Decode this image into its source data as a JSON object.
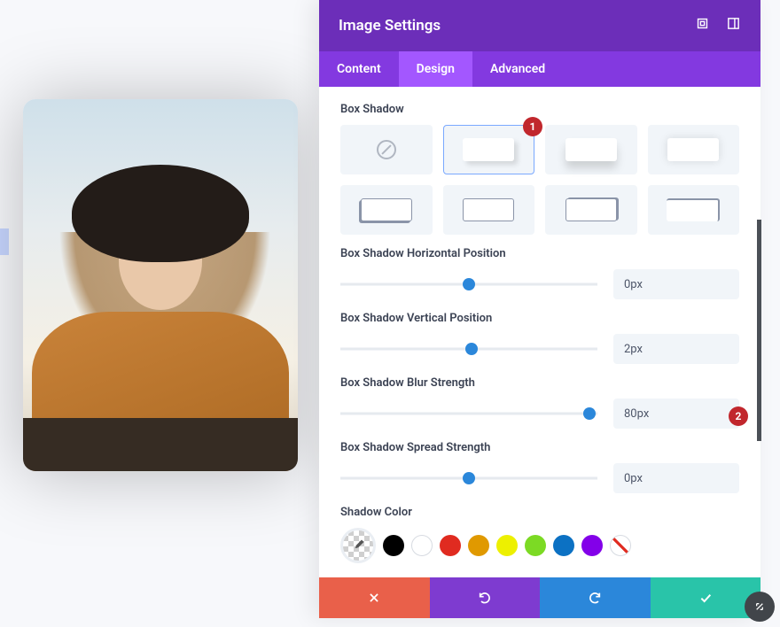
{
  "header": {
    "title": "Image Settings"
  },
  "tabs": {
    "content": "Content",
    "design": "Design",
    "advanced": "Advanced",
    "active": "design"
  },
  "section": {
    "box_shadow_label": "Box Shadow",
    "presets": {
      "selected_index": 1
    }
  },
  "sliders": {
    "horizontal": {
      "label": "Box Shadow Horizontal Position",
      "value": "0px",
      "pos": 50
    },
    "vertical": {
      "label": "Box Shadow Vertical Position",
      "value": "2px",
      "pos": 51
    },
    "blur": {
      "label": "Box Shadow Blur Strength",
      "value": "80px",
      "pos": 97
    },
    "spread": {
      "label": "Box Shadow Spread Strength",
      "value": "0px",
      "pos": 50
    }
  },
  "shadow_color": {
    "label": "Shadow Color"
  },
  "colors": [
    "black",
    "white",
    "red",
    "orange",
    "yellow",
    "green",
    "blue",
    "purple",
    "clear"
  ],
  "annotations": {
    "badge1": "1",
    "badge2": "2"
  }
}
